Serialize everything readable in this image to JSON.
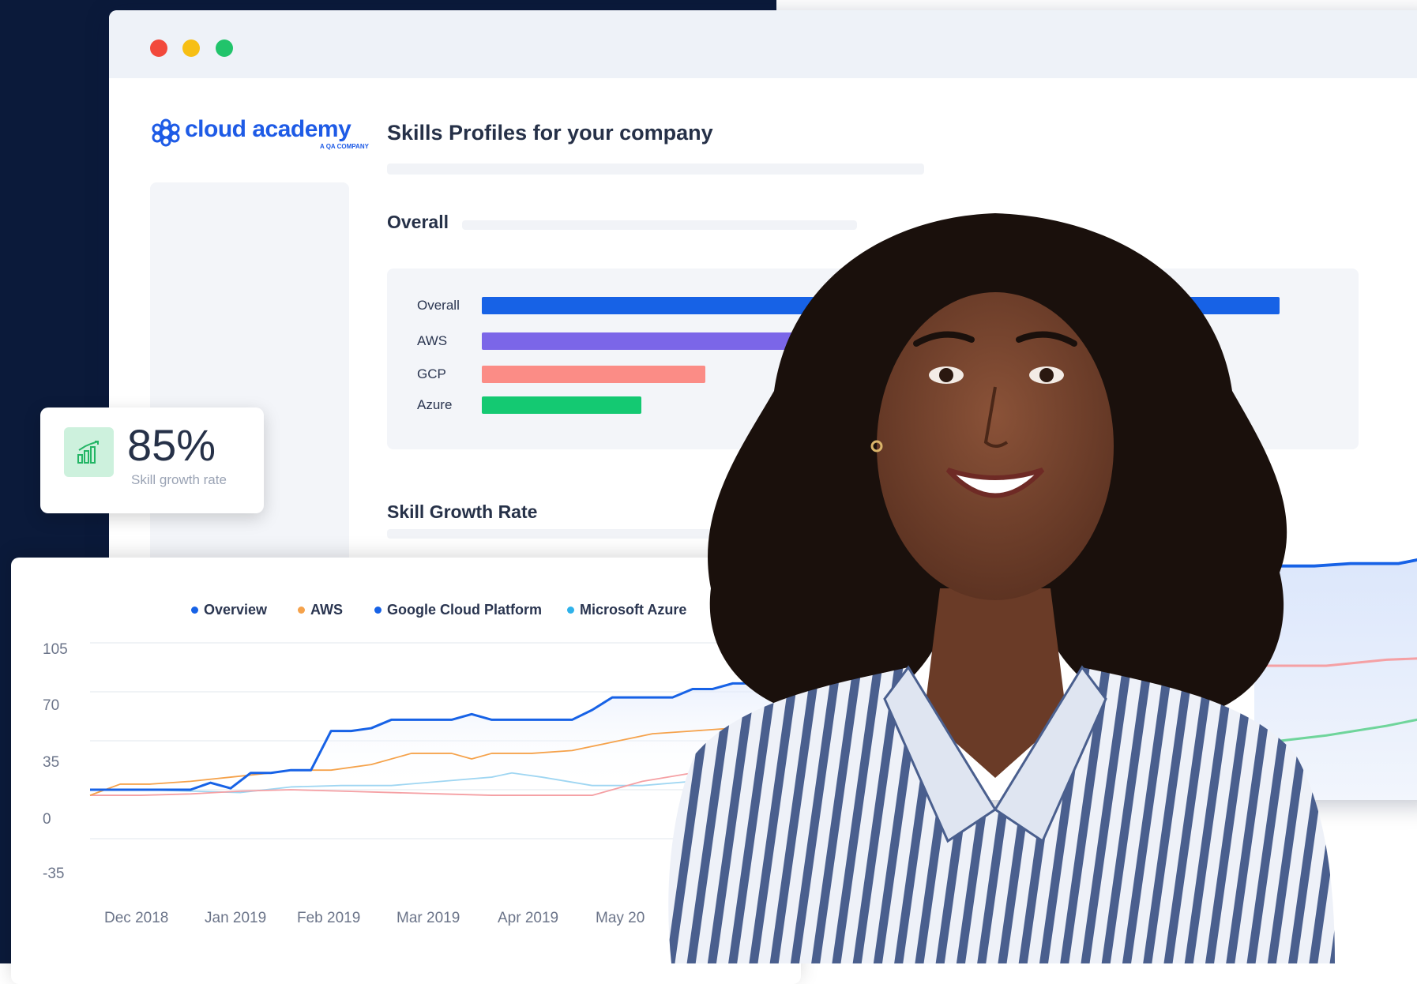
{
  "window": {
    "logo_text": "cloud academy",
    "logo_sub": "A QA COMPANY",
    "page_title": "Skills Profiles for your company",
    "section_overall": "Overall",
    "section_growth": "Skill Growth Rate"
  },
  "skill_bars": [
    {
      "label": "Overall",
      "value": 1.0,
      "color": "#1762e6"
    },
    {
      "label": "AWS",
      "value": 0.5,
      "color": "#7b66e8"
    },
    {
      "label": "GCP",
      "value": 0.28,
      "color": "#fb8c86"
    },
    {
      "label": "Azure",
      "value": 0.2,
      "color": "#14c972"
    }
  ],
  "stat_card": {
    "value": "85%",
    "label": "Skill growth rate",
    "icon": "bar-chart-up-icon"
  },
  "chart_data": {
    "type": "line",
    "xlabel": "",
    "ylabel": "",
    "ylim": [
      -35,
      105
    ],
    "yticks": [
      "105",
      "70",
      "35",
      "0",
      "-35"
    ],
    "xticks": [
      "Dec 2018",
      "Jan 2019",
      "Feb 2019",
      "Mar 2019",
      "Apr 2019",
      "May 20"
    ],
    "series": [
      {
        "name": "Overview",
        "color": "#1762e6",
        "x": [
          0,
          0.2,
          0.4,
          0.6,
          0.8,
          1.0,
          1.2,
          1.4,
          1.6,
          1.8,
          2.0,
          2.2,
          2.4,
          2.6,
          2.8,
          3.0,
          3.2,
          3.4,
          3.6,
          3.8,
          4.0,
          4.2,
          4.4,
          4.6,
          4.8,
          5.0,
          5.2,
          5.4,
          5.6,
          5.8,
          6.0,
          6.2,
          6.4,
          6.6,
          6.8,
          7.0
        ],
        "y": [
          0,
          0,
          0,
          0,
          0,
          0,
          5,
          1,
          12,
          12,
          14,
          14,
          42,
          42,
          44,
          50,
          50,
          50,
          50,
          54,
          50,
          50,
          50,
          50,
          50,
          57,
          66,
          66,
          66,
          66,
          72,
          72,
          76,
          76,
          92,
          110
        ]
      },
      {
        "name": "AWS",
        "color": "#f5a24b",
        "x": [
          0,
          0.3,
          0.6,
          1.0,
          1.4,
          1.8,
          2.0,
          2.4,
          2.8,
          3.2,
          3.6,
          3.8,
          4.0,
          4.4,
          4.8,
          5.2,
          5.6,
          6.0,
          6.4,
          6.8
        ],
        "y": [
          -4,
          4,
          4,
          6,
          9,
          12,
          14,
          14,
          18,
          26,
          26,
          22,
          26,
          26,
          28,
          34,
          40,
          42,
          44,
          44
        ]
      },
      {
        "name": "Google Cloud Platform",
        "color": "#f5a0a4",
        "x": [
          0,
          0.5,
          1.0,
          1.5,
          2.0,
          2.5,
          3.0,
          3.5,
          4.0,
          4.5,
          5.0,
          5.5,
          6.0,
          6.4
        ],
        "y": [
          -4,
          -4,
          -3,
          -1,
          0,
          -1,
          -2,
          -3,
          -4,
          -4,
          -4,
          6,
          12,
          20
        ]
      },
      {
        "name": "Microsoft Azure",
        "color": "#9fd6f2",
        "x": [
          0,
          0.5,
          1.0,
          1.5,
          2.0,
          2.5,
          3.0,
          3.5,
          4.0,
          4.2,
          4.5,
          5.0,
          5.5,
          6.0,
          6.4
        ],
        "y": [
          0,
          0,
          -1,
          -2,
          2,
          3,
          3,
          6,
          9,
          12,
          9,
          3,
          3,
          6,
          12
        ]
      }
    ]
  },
  "colors": {
    "dark_background": "#0b1a3a",
    "brand_blue": "#1e5be6"
  }
}
